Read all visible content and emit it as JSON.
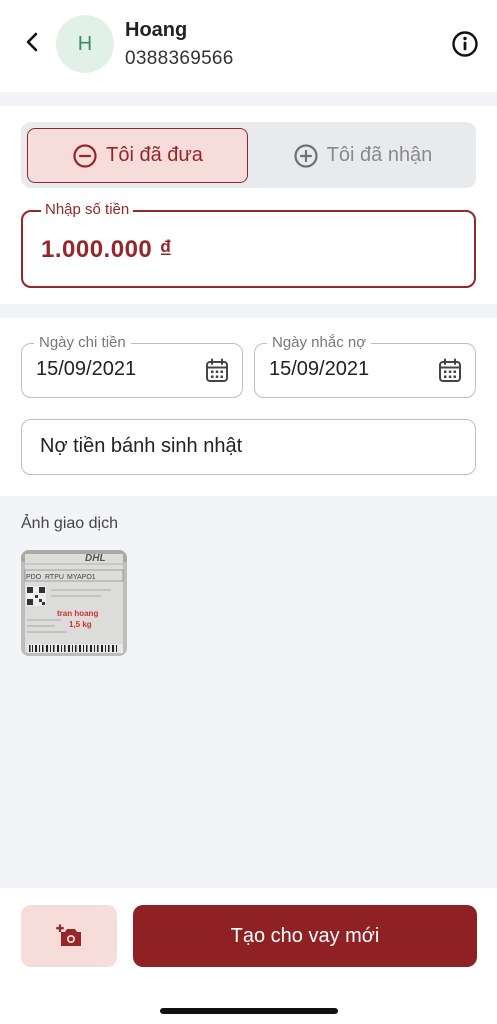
{
  "contact": {
    "initial": "H",
    "name": "Hoang",
    "phone": "0388369566"
  },
  "toggle": {
    "give_label": "Tôi đã đưa",
    "receive_label": "Tôi đã nhận",
    "selected": "give"
  },
  "amount": {
    "label": "Nhập số tiền",
    "value": "1.000.000 ₫"
  },
  "dates": {
    "spend_label": "Ngày chi tiền",
    "spend_value": "15/09/2021",
    "remind_label": "Ngày nhắc nợ",
    "remind_value": "15/09/2021"
  },
  "note": {
    "value": "Nợ tiền bánh sinh nhật"
  },
  "photos": {
    "label": "Ảnh giao dịch",
    "thumb": {
      "brand": "DHL",
      "codes": [
        "PDO",
        "RTPU",
        "MYAPO1"
      ],
      "handwritten_name": "tran hoang",
      "handwritten_weight": "1,5 kg"
    }
  },
  "footer": {
    "create_label": "Tạo cho vay mới"
  },
  "colors": {
    "accent": "#96262a",
    "accent_light": "#f6ddd9",
    "avatar_bg": "#e2f1e8",
    "avatar_fg": "#3e8e57"
  },
  "icons": [
    "back-chevron-icon",
    "info-icon",
    "minus-circle-icon",
    "plus-circle-icon",
    "calendar-icon",
    "add-photo-icon"
  ]
}
